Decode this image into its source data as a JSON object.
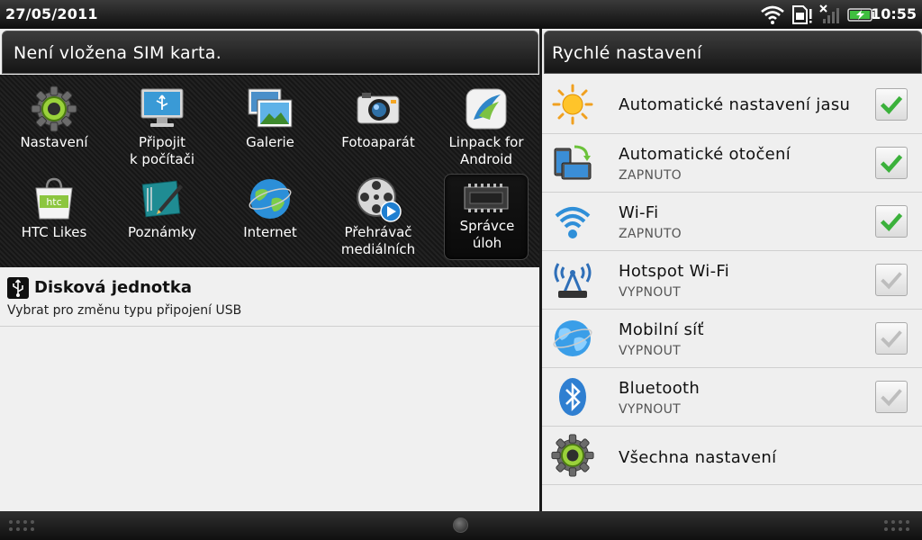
{
  "status_bar": {
    "date": "27/05/2011",
    "time": "10:55",
    "icons": [
      "wifi-icon",
      "sim-missing-icon",
      "signal-none-icon",
      "battery-charging-icon"
    ]
  },
  "left_panel": {
    "header": "Není vložena SIM karta.",
    "apps": [
      {
        "label": "Nastavení",
        "icon": "gear-icon"
      },
      {
        "label": "Připojit\nk počítači",
        "icon": "monitor-usb-icon"
      },
      {
        "label": "Galerie",
        "icon": "gallery-icon"
      },
      {
        "label": "Fotoaparát",
        "icon": "camera-icon"
      },
      {
        "label": "Linpack for\nAndroid",
        "icon": "linpack-icon"
      },
      {
        "label": "HTC Likes",
        "icon": "htc-likes-icon"
      },
      {
        "label": "Poznámky",
        "icon": "notes-icon"
      },
      {
        "label": "Internet",
        "icon": "globe-icon"
      },
      {
        "label": "Přehrávač\nmediálních",
        "icon": "media-player-icon"
      },
      {
        "label": "Správce úloh",
        "icon": "task-manager-icon"
      }
    ],
    "notification": {
      "title": "Disková jednotka",
      "subtitle": "Vybrat pro změnu typu připojení USB",
      "icon": "usb-icon"
    }
  },
  "right_panel": {
    "header": "Rychlé nastavení",
    "items": [
      {
        "label": "Automatické nastavení jasu",
        "status": "",
        "checked": true,
        "icon": "sun-icon"
      },
      {
        "label": "Automatické otočení",
        "status": "ZAPNUTO",
        "checked": true,
        "icon": "rotate-icon"
      },
      {
        "label": "Wi-Fi",
        "status": "ZAPNUTO",
        "checked": true,
        "icon": "wifi-icon"
      },
      {
        "label": "Hotspot Wi-Fi",
        "status": "VYPNOUT",
        "checked": false,
        "icon": "hotspot-icon"
      },
      {
        "label": "Mobilní síť",
        "status": "VYPNOUT",
        "checked": false,
        "icon": "globe-icon"
      },
      {
        "label": "Bluetooth",
        "status": "VYPNOUT",
        "checked": false,
        "icon": "bluetooth-icon"
      },
      {
        "label": "Všechna nastavení",
        "status": "",
        "checked": null,
        "icon": "gear-icon"
      }
    ]
  },
  "colors": {
    "check_green": "#3bb13b",
    "check_grey": "#bdbdbd"
  }
}
